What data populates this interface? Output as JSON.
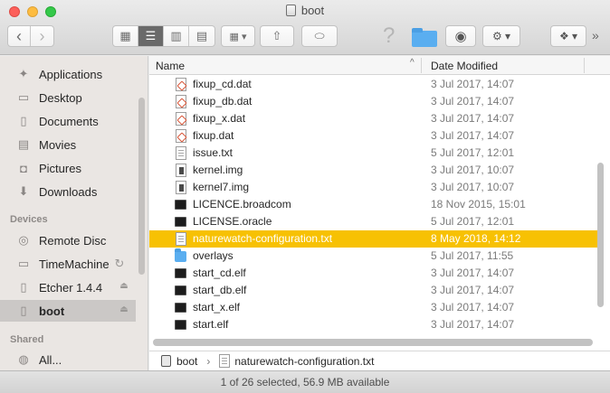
{
  "window": {
    "title": "boot"
  },
  "toolbar": {
    "back_glyph": "‹",
    "forward_glyph": "›",
    "views": [
      {
        "name": "icon-view-icon",
        "glyph": "▦",
        "active": false
      },
      {
        "name": "list-view-icon",
        "glyph": "☰",
        "active": true
      },
      {
        "name": "column-view-icon",
        "glyph": "▥",
        "active": false
      },
      {
        "name": "cover-flow-icon",
        "glyph": "▤",
        "active": false
      }
    ],
    "arrange_glyph": "▦ ▾",
    "share_glyph": "⇧",
    "tag_glyph": "⬭",
    "help_glyph": "?",
    "eye_glyph": "◉",
    "action_glyph": "⚙ ▾",
    "dropbox_glyph": "❖ ▾",
    "overflow_glyph": "»"
  },
  "sidebar": {
    "favorites": [
      {
        "label": "Applications",
        "icon": "applications-icon",
        "glyph": "✦"
      },
      {
        "label": "Desktop",
        "icon": "desktop-icon",
        "glyph": "▭"
      },
      {
        "label": "Documents",
        "icon": "documents-icon",
        "glyph": "▯"
      },
      {
        "label": "Movies",
        "icon": "movies-icon",
        "glyph": "▤"
      },
      {
        "label": "Pictures",
        "icon": "pictures-icon",
        "glyph": "◘"
      },
      {
        "label": "Downloads",
        "icon": "downloads-icon",
        "glyph": "⬇"
      }
    ],
    "devices_heading": "Devices",
    "devices": [
      {
        "label": "Remote Disc",
        "icon": "remote-disc-icon",
        "glyph": "◎",
        "eject": false,
        "selected": false
      },
      {
        "label": "TimeMachine",
        "icon": "timemachine-icon",
        "glyph": "▭",
        "eject": false,
        "spinner": "↻",
        "selected": false
      },
      {
        "label": "Etcher 1.4.4",
        "icon": "disk-icon",
        "glyph": "▯",
        "eject": true,
        "selected": false
      },
      {
        "label": "boot",
        "icon": "disk-icon",
        "glyph": "▯",
        "eject": true,
        "selected": true
      }
    ],
    "eject_glyph": "⏏",
    "shared_heading": "Shared",
    "shared": [
      {
        "label": "All...",
        "icon": "network-icon",
        "glyph": "◍"
      }
    ]
  },
  "list": {
    "header_name": "Name",
    "header_date": "Date Modified",
    "sort_glyph": "^",
    "files": [
      {
        "name": "fixup_cd.dat",
        "date": "3 Jul 2017, 14:07",
        "type": "red"
      },
      {
        "name": "fixup_db.dat",
        "date": "3 Jul 2017, 14:07",
        "type": "red"
      },
      {
        "name": "fixup_x.dat",
        "date": "3 Jul 2017, 14:07",
        "type": "red"
      },
      {
        "name": "fixup.dat",
        "date": "3 Jul 2017, 14:07",
        "type": "red"
      },
      {
        "name": "issue.txt",
        "date": "5 Jul 2017, 12:01",
        "type": "txt"
      },
      {
        "name": "kernel.img",
        "date": "3 Jul 2017, 10:07",
        "type": "bin"
      },
      {
        "name": "kernel7.img",
        "date": "3 Jul 2017, 10:07",
        "type": "bin"
      },
      {
        "name": "LICENCE.broadcom",
        "date": "18 Nov 2015, 15:01",
        "type": "term"
      },
      {
        "name": "LICENSE.oracle",
        "date": "5 Jul 2017, 12:01",
        "type": "term"
      },
      {
        "name": "naturewatch-configuration.txt",
        "date": "8 May 2018, 14:12",
        "type": "txt",
        "selected": true
      },
      {
        "name": "overlays",
        "date": "5 Jul 2017, 11:55",
        "type": "folder"
      },
      {
        "name": "start_cd.elf",
        "date": "3 Jul 2017, 14:07",
        "type": "term"
      },
      {
        "name": "start_db.elf",
        "date": "3 Jul 2017, 14:07",
        "type": "term"
      },
      {
        "name": "start_x.elf",
        "date": "3 Jul 2017, 14:07",
        "type": "term"
      },
      {
        "name": "start.elf",
        "date": "3 Jul 2017, 14:07",
        "type": "term"
      }
    ]
  },
  "pathbar": {
    "root": "boot",
    "chevron": "›",
    "file": "naturewatch-configuration.txt"
  },
  "status": {
    "text": "1 of 26 selected, 56.9 MB available"
  }
}
